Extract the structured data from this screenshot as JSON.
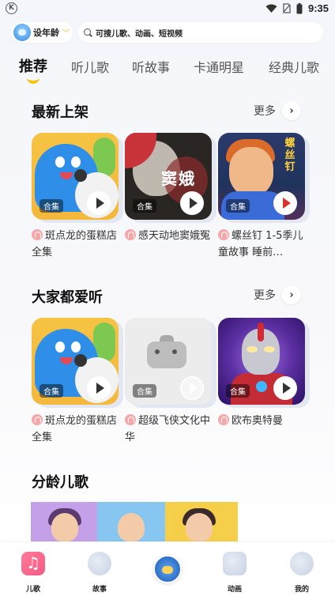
{
  "status_bar": {
    "left_icon": "K",
    "time": "9:35",
    "icons": [
      "wifi-icon",
      "no-sim-icon",
      "battery-icon"
    ]
  },
  "header": {
    "age_selector": {
      "label": "设年龄",
      "icon": "chevron-down-icon"
    },
    "search": {
      "placeholder": "可搜儿歌、动画、短视频"
    }
  },
  "tabs": [
    {
      "label": "推荐",
      "active": true
    },
    {
      "label": "听儿歌",
      "active": false
    },
    {
      "label": "听故事",
      "active": false
    },
    {
      "label": "卡通明星",
      "active": false
    },
    {
      "label": "经典儿歌",
      "active": false
    }
  ],
  "sections": {
    "new": {
      "title": "最新上架",
      "more": "更多",
      "cards": [
        {
          "badge": "合集",
          "title": "斑点龙的蛋糕店全集"
        },
        {
          "badge": "合集",
          "title": "感天动地窦娥冤",
          "cover_text": "窦娥"
        },
        {
          "badge": "合集",
          "title": "螺丝钉 1-5季儿童故事 睡前…",
          "cover_text": "螺丝钉"
        }
      ]
    },
    "popular": {
      "title": "大家都爱听",
      "more": "更多",
      "cards": [
        {
          "badge": "合集",
          "title": "斑点龙的蛋糕店全集"
        },
        {
          "badge": "合集",
          "title": "超级飞侠文化中华"
        },
        {
          "badge": "合集",
          "title": "欧布奥特曼"
        }
      ]
    },
    "age": {
      "title": "分龄儿歌"
    }
  },
  "bottom_nav": [
    {
      "label": "儿歌",
      "icon": "music-icon",
      "active": true
    },
    {
      "label": "故事",
      "icon": "story-icon",
      "active": false
    },
    {
      "label": "",
      "icon": "center-avatar-icon",
      "active": false
    },
    {
      "label": "动画",
      "icon": "cartoon-icon",
      "active": false
    },
    {
      "label": "我的",
      "icon": "mine-icon",
      "active": false
    }
  ],
  "colors": {
    "accent": "#f5c400",
    "badge_bg": "#000000",
    "listen_icon": "#f7a7a7"
  }
}
